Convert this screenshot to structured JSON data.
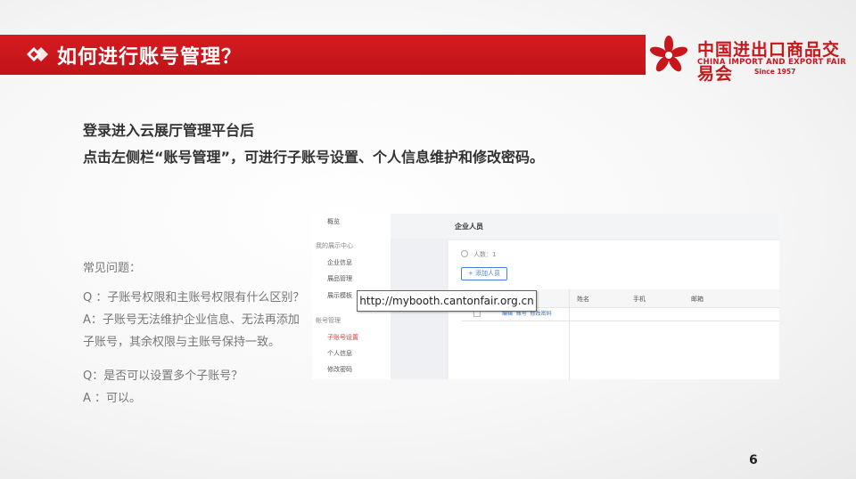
{
  "header": {
    "title": "如何进行账号管理？"
  },
  "logo": {
    "cn": "中国进出口商品交易会",
    "en": "CHINA IMPORT AND EXPORT FAIR",
    "since": "Since 1957",
    "color": "#c8161d"
  },
  "intro": {
    "line1": "登录进入云展厅管理平台后",
    "line2": "点击左侧栏“账号管理”，可进行子账号设置、个人信息维护和修改密码。"
  },
  "faq": {
    "heading": "常见问题：",
    "q1": "Q ：子账号权限和主账号权限有什么区别？",
    "a1_line1": "A：子账号无法维护企业信息、无法再添加",
    "a1_line2": "子账号，其余权限与主账号保持一致。",
    "q2": "Q：是否可以设置多个子账号？",
    "a2": "A ：可以。"
  },
  "screenshot": {
    "sidebar": {
      "overview": "概览",
      "my_center": "我的展示中心",
      "company_info": "企业信息",
      "product_mgmt": "展品管理",
      "display_template": "展示模板",
      "account_mgmt": "帐号管理",
      "sub_account": "子账号设置",
      "personal_info": "个人信息",
      "change_password": "修改密码"
    },
    "main_title": "企业人员",
    "people_count": "人数：1",
    "add_button": "+ 添加人员",
    "columns": [
      "姓名",
      "手机",
      "邮箱"
    ],
    "row_actions": "编辑  账号  修改密码"
  },
  "url_tooltip": "http://mybooth.cantonfair.org.cn",
  "page_number": "6",
  "colors": {
    "brand_red": "#c8161d",
    "active_link": "#e0393e",
    "link_blue": "#3a6fc4"
  }
}
